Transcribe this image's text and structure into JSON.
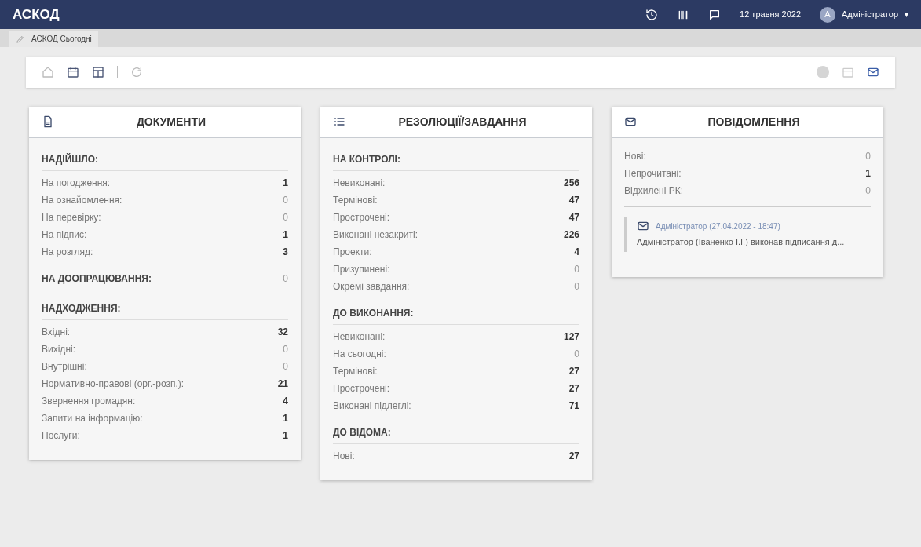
{
  "app_title": "АСКОД",
  "topbar": {
    "date": "12 травня 2022",
    "avatar_letter": "A",
    "user": "Адміністратор",
    "menu_caret": "▾"
  },
  "tabs": [
    {
      "label": "АСКОД Сьогодні",
      "selected": true
    }
  ],
  "cards": [
    {
      "kind": "document",
      "title": "ДОКУМЕНТИ",
      "sections": [
        {
          "heading": "НАДІЙШЛО:",
          "rows": [
            {
              "label": "На погодження:",
              "value": "1",
              "strong": true
            },
            {
              "label": "На ознайомлення:",
              "value": "0",
              "strong": false
            },
            {
              "label": "На перевірку:",
              "value": "0",
              "strong": false
            },
            {
              "label": "На підпис:",
              "value": "1",
              "strong": true
            },
            {
              "label": "На розгляд:",
              "value": "3",
              "strong": true
            }
          ]
        },
        {
          "heading": "НА ДООПРАЦЮВАННЯ:",
          "value": "0",
          "strong": false
        },
        {
          "heading": "НАДХОДЖЕННЯ:",
          "rows": [
            {
              "label": "Вхідні:",
              "value": "32",
              "strong": true
            },
            {
              "label": "Вихідні:",
              "value": "0",
              "strong": false
            },
            {
              "label": "Внутрішні:",
              "value": "0",
              "strong": false
            },
            {
              "label": "Нормативно-правові (орг.-розп.):",
              "value": "21",
              "strong": true
            },
            {
              "label": "Звернення громадян:",
              "value": "4",
              "strong": true
            },
            {
              "label": "Запити на інформацію:",
              "value": "1",
              "strong": true
            },
            {
              "label": "Послуги:",
              "value": "1",
              "strong": true
            }
          ]
        }
      ]
    },
    {
      "kind": "list",
      "title": "РЕЗОЛЮЦІЇ/ЗАВДАННЯ",
      "sections": [
        {
          "heading": "НА КОНТРОЛІ:",
          "rows": [
            {
              "label": "Невиконані:",
              "value": "256",
              "strong": true
            },
            {
              "label": "Термінові:",
              "value": "47",
              "strong": true
            },
            {
              "label": "Прострочені:",
              "value": "47",
              "strong": true
            },
            {
              "label": "Виконані незакриті:",
              "value": "226",
              "strong": true
            },
            {
              "label": "Проекти:",
              "value": "4",
              "strong": true
            },
            {
              "label": "Призупинені:",
              "value": "0",
              "strong": false
            },
            {
              "label": "Окремі завдання:",
              "value": "0",
              "strong": false
            }
          ]
        },
        {
          "heading": "ДО ВИКОНАННЯ:",
          "rows": [
            {
              "label": "Невиконані:",
              "value": "127",
              "strong": true
            },
            {
              "label": "На сьогодні:",
              "value": "0",
              "strong": false
            },
            {
              "label": "Термінові:",
              "value": "27",
              "strong": true
            },
            {
              "label": "Прострочені:",
              "value": "27",
              "strong": true
            },
            {
              "label": "Виконані підлеглі:",
              "value": "71",
              "strong": true
            }
          ]
        },
        {
          "heading": "ДО ВІДОМА:",
          "rows": [
            {
              "label": "Нові:",
              "value": "27",
              "strong": true
            }
          ]
        }
      ]
    },
    {
      "kind": "mail",
      "title": "ПОВІДОМЛЕННЯ",
      "sections": [
        {
          "rows": [
            {
              "label": "Нові:",
              "value": "0",
              "strong": false
            },
            {
              "label": "Непрочитані:",
              "value": "1",
              "strong": true
            },
            {
              "label": "Відхилені РК:",
              "value": "0",
              "strong": false
            }
          ]
        }
      ],
      "messages": [
        {
          "sender": "Адміністратор (27.04.2022 - 18:47)",
          "text": "Адміністратор (Іваненко І.І.) виконав підписання д..."
        }
      ]
    }
  ]
}
